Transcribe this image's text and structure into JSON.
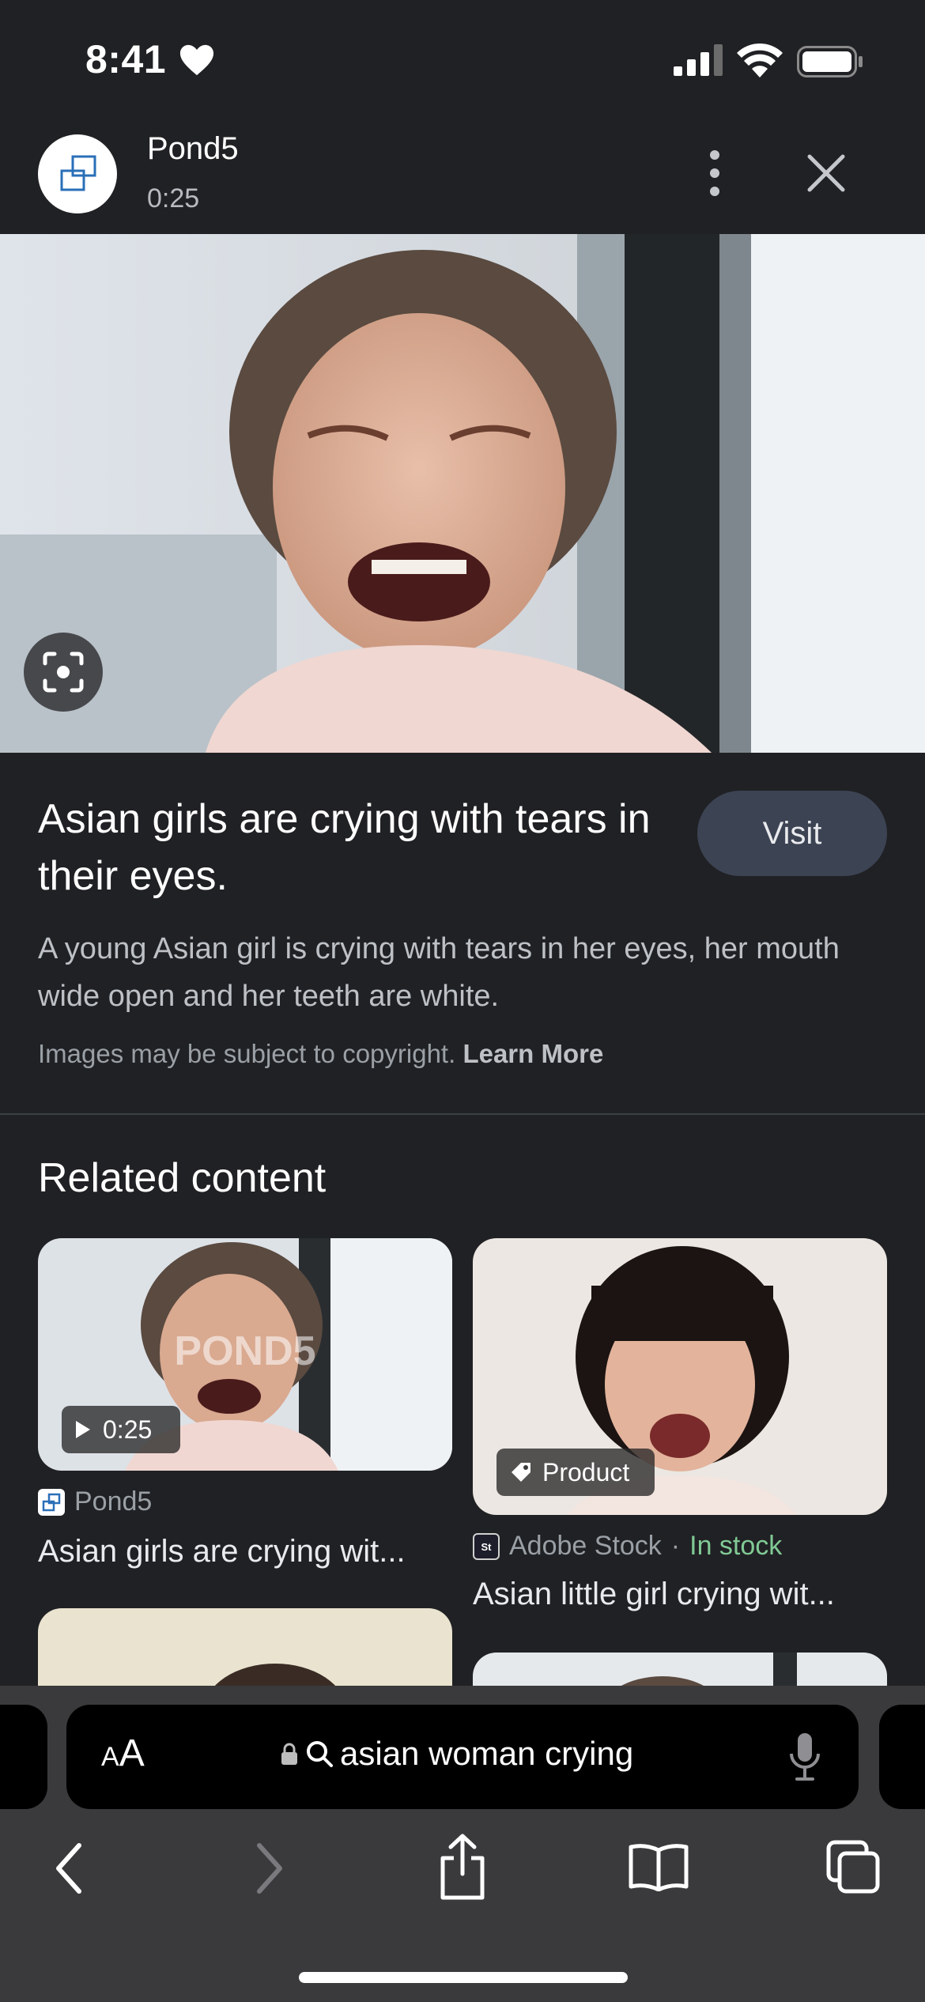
{
  "status_bar": {
    "time": "8:41"
  },
  "header": {
    "source_name": "Pond5",
    "duration": "0:25"
  },
  "result": {
    "title": "Asian girls are crying with tears in their eyes.",
    "visit_label": "Visit",
    "description": "A young Asian girl is crying with tears in her eyes, her mouth wide open and her teeth are white.",
    "copyright_text": "Images may be subject to copyright.",
    "learn_more": "Learn More"
  },
  "related": {
    "heading": "Related content",
    "items": [
      {
        "source": "Pond5",
        "title": "Asian girls are crying wit...",
        "badge": "0:25",
        "watermark": "POND5"
      },
      {
        "source": "Adobe Stock",
        "separator": "·",
        "availability": "In stock",
        "title": "Asian little girl crying wit...",
        "badge": "Product"
      }
    ]
  },
  "browser": {
    "aa_label_big": "A",
    "aa_label_small": "A",
    "search_query": "asian woman crying"
  },
  "icons": [
    "heart-icon",
    "signal-icon",
    "wifi-icon",
    "battery-icon",
    "pond5-logo-icon",
    "more-vert-icon",
    "close-icon",
    "lens-icon",
    "play-icon",
    "tag-icon",
    "lock-icon",
    "search-icon",
    "mic-icon",
    "back-icon",
    "forward-icon",
    "share-icon",
    "bookmarks-icon",
    "tabs-icon"
  ],
  "colors": {
    "background": "#202124",
    "visit_button": "#3c4353",
    "in_stock": "#81c995"
  }
}
